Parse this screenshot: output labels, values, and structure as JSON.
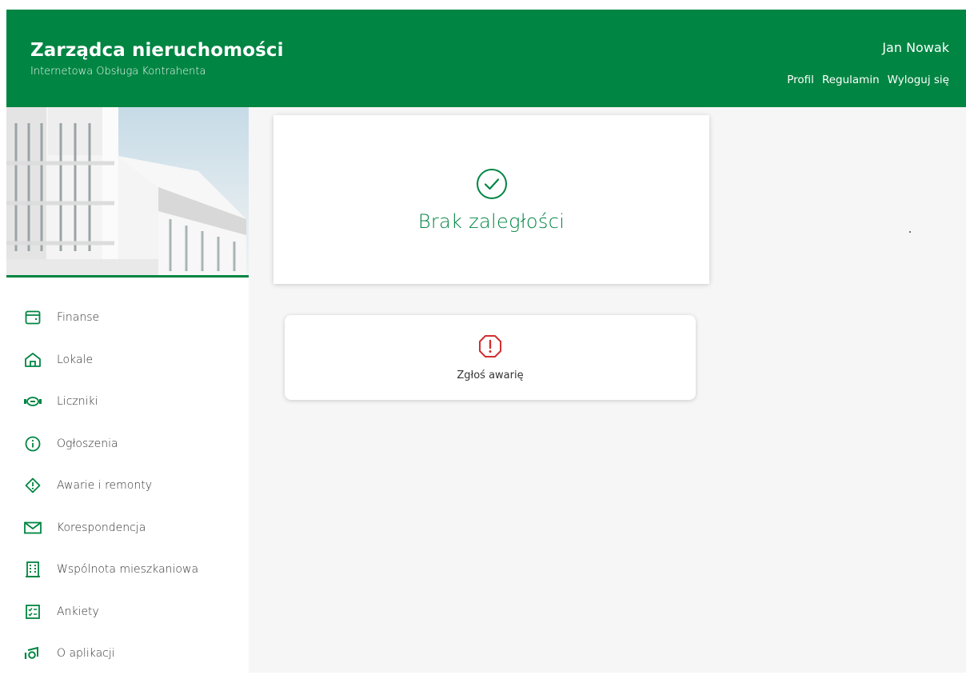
{
  "header": {
    "title": "Zarządca nieruchomości",
    "subtitle": "Internetowa Obsługa Kontrahenta",
    "user_name": "Jan Nowak",
    "links": [
      "Profil",
      "Regulamin",
      "Wyloguj się"
    ]
  },
  "sidebar": {
    "items": [
      {
        "label": "Finanse",
        "icon": "wallet-icon"
      },
      {
        "label": "Lokale",
        "icon": "home-icon"
      },
      {
        "label": "Liczniki",
        "icon": "meter-icon"
      },
      {
        "label": "Ogłoszenia",
        "icon": "info-icon"
      },
      {
        "label": "Awarie i remonty",
        "icon": "warning-octagon-icon"
      },
      {
        "label": "Korespondencja",
        "icon": "envelope-icon"
      },
      {
        "label": "Wspólnota mieszkaniowa",
        "icon": "building-icon"
      },
      {
        "label": "Ankiety",
        "icon": "checklist-icon"
      },
      {
        "label": "O aplikacji",
        "icon": "about-app-icon"
      }
    ]
  },
  "main": {
    "status_text": "Brak zaległości",
    "report_label": "Zgłoś awarię"
  },
  "colors": {
    "brand": "#008542",
    "alert": "#d32f2f",
    "background": "#f6f6f6"
  }
}
